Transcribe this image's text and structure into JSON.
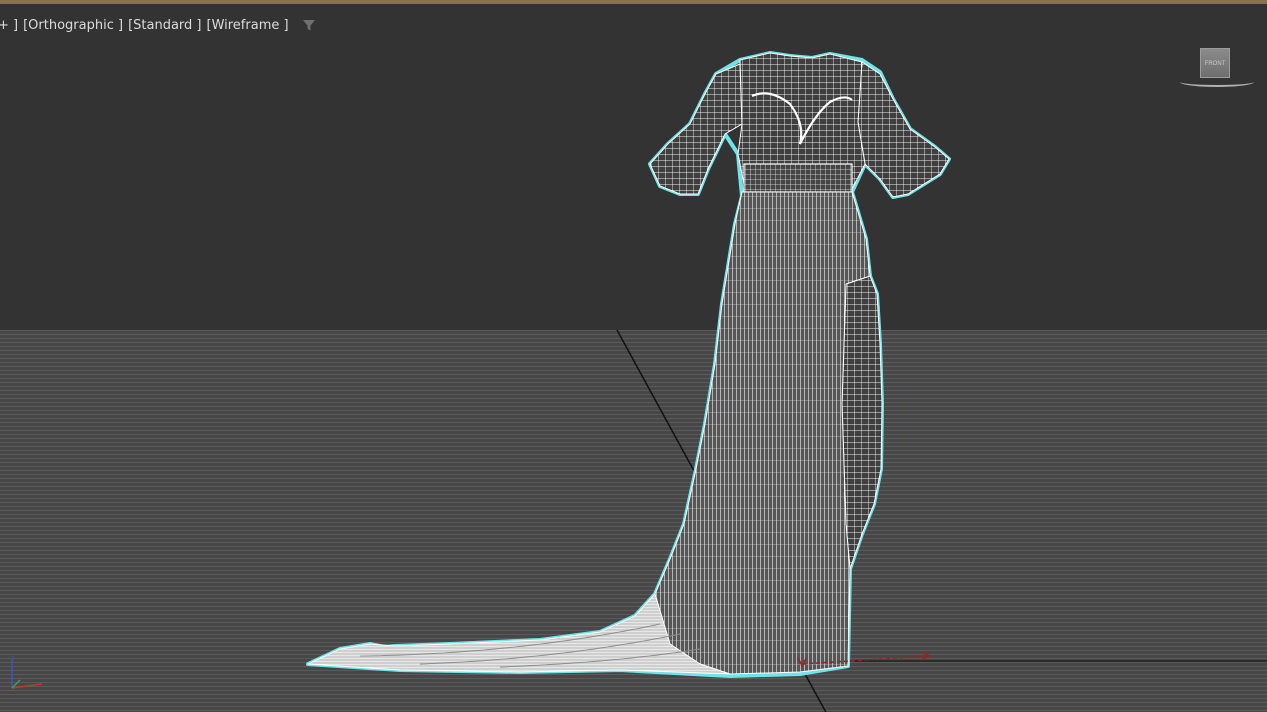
{
  "viewport": {
    "labels": {
      "plus": "+ ]",
      "projection": "[Orthographic ]",
      "shading": "[Standard ]",
      "display_mode": "[Wireframe ]"
    },
    "filter_icon": "funnel-icon",
    "viewcube": {
      "face": "FRONT"
    }
  },
  "colors": {
    "viewport_bg": "#333333",
    "floor": "#4a4a4a",
    "selection_outline": "#6fe3ea",
    "wireframe": "#ffffff",
    "title_border": "#8a7446"
  }
}
